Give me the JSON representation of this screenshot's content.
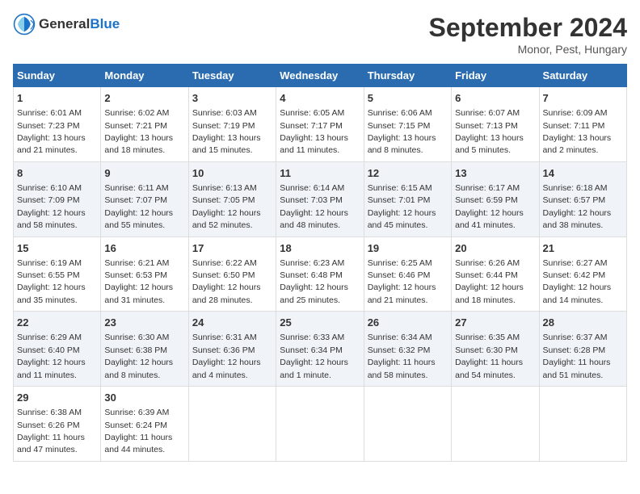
{
  "header": {
    "logo_general": "General",
    "logo_blue": "Blue",
    "title": "September 2024",
    "subtitle": "Monor, Pest, Hungary"
  },
  "columns": [
    "Sunday",
    "Monday",
    "Tuesday",
    "Wednesday",
    "Thursday",
    "Friday",
    "Saturday"
  ],
  "weeks": [
    [
      {
        "day": "1",
        "sunrise": "Sunrise: 6:01 AM",
        "sunset": "Sunset: 7:23 PM",
        "daylight": "Daylight: 13 hours and 21 minutes."
      },
      {
        "day": "2",
        "sunrise": "Sunrise: 6:02 AM",
        "sunset": "Sunset: 7:21 PM",
        "daylight": "Daylight: 13 hours and 18 minutes."
      },
      {
        "day": "3",
        "sunrise": "Sunrise: 6:03 AM",
        "sunset": "Sunset: 7:19 PM",
        "daylight": "Daylight: 13 hours and 15 minutes."
      },
      {
        "day": "4",
        "sunrise": "Sunrise: 6:05 AM",
        "sunset": "Sunset: 7:17 PM",
        "daylight": "Daylight: 13 hours and 11 minutes."
      },
      {
        "day": "5",
        "sunrise": "Sunrise: 6:06 AM",
        "sunset": "Sunset: 7:15 PM",
        "daylight": "Daylight: 13 hours and 8 minutes."
      },
      {
        "day": "6",
        "sunrise": "Sunrise: 6:07 AM",
        "sunset": "Sunset: 7:13 PM",
        "daylight": "Daylight: 13 hours and 5 minutes."
      },
      {
        "day": "7",
        "sunrise": "Sunrise: 6:09 AM",
        "sunset": "Sunset: 7:11 PM",
        "daylight": "Daylight: 13 hours and 2 minutes."
      }
    ],
    [
      {
        "day": "8",
        "sunrise": "Sunrise: 6:10 AM",
        "sunset": "Sunset: 7:09 PM",
        "daylight": "Daylight: 12 hours and 58 minutes."
      },
      {
        "day": "9",
        "sunrise": "Sunrise: 6:11 AM",
        "sunset": "Sunset: 7:07 PM",
        "daylight": "Daylight: 12 hours and 55 minutes."
      },
      {
        "day": "10",
        "sunrise": "Sunrise: 6:13 AM",
        "sunset": "Sunset: 7:05 PM",
        "daylight": "Daylight: 12 hours and 52 minutes."
      },
      {
        "day": "11",
        "sunrise": "Sunrise: 6:14 AM",
        "sunset": "Sunset: 7:03 PM",
        "daylight": "Daylight: 12 hours and 48 minutes."
      },
      {
        "day": "12",
        "sunrise": "Sunrise: 6:15 AM",
        "sunset": "Sunset: 7:01 PM",
        "daylight": "Daylight: 12 hours and 45 minutes."
      },
      {
        "day": "13",
        "sunrise": "Sunrise: 6:17 AM",
        "sunset": "Sunset: 6:59 PM",
        "daylight": "Daylight: 12 hours and 41 minutes."
      },
      {
        "day": "14",
        "sunrise": "Sunrise: 6:18 AM",
        "sunset": "Sunset: 6:57 PM",
        "daylight": "Daylight: 12 hours and 38 minutes."
      }
    ],
    [
      {
        "day": "15",
        "sunrise": "Sunrise: 6:19 AM",
        "sunset": "Sunset: 6:55 PM",
        "daylight": "Daylight: 12 hours and 35 minutes."
      },
      {
        "day": "16",
        "sunrise": "Sunrise: 6:21 AM",
        "sunset": "Sunset: 6:53 PM",
        "daylight": "Daylight: 12 hours and 31 minutes."
      },
      {
        "day": "17",
        "sunrise": "Sunrise: 6:22 AM",
        "sunset": "Sunset: 6:50 PM",
        "daylight": "Daylight: 12 hours and 28 minutes."
      },
      {
        "day": "18",
        "sunrise": "Sunrise: 6:23 AM",
        "sunset": "Sunset: 6:48 PM",
        "daylight": "Daylight: 12 hours and 25 minutes."
      },
      {
        "day": "19",
        "sunrise": "Sunrise: 6:25 AM",
        "sunset": "Sunset: 6:46 PM",
        "daylight": "Daylight: 12 hours and 21 minutes."
      },
      {
        "day": "20",
        "sunrise": "Sunrise: 6:26 AM",
        "sunset": "Sunset: 6:44 PM",
        "daylight": "Daylight: 12 hours and 18 minutes."
      },
      {
        "day": "21",
        "sunrise": "Sunrise: 6:27 AM",
        "sunset": "Sunset: 6:42 PM",
        "daylight": "Daylight: 12 hours and 14 minutes."
      }
    ],
    [
      {
        "day": "22",
        "sunrise": "Sunrise: 6:29 AM",
        "sunset": "Sunset: 6:40 PM",
        "daylight": "Daylight: 12 hours and 11 minutes."
      },
      {
        "day": "23",
        "sunrise": "Sunrise: 6:30 AM",
        "sunset": "Sunset: 6:38 PM",
        "daylight": "Daylight: 12 hours and 8 minutes."
      },
      {
        "day": "24",
        "sunrise": "Sunrise: 6:31 AM",
        "sunset": "Sunset: 6:36 PM",
        "daylight": "Daylight: 12 hours and 4 minutes."
      },
      {
        "day": "25",
        "sunrise": "Sunrise: 6:33 AM",
        "sunset": "Sunset: 6:34 PM",
        "daylight": "Daylight: 12 hours and 1 minute."
      },
      {
        "day": "26",
        "sunrise": "Sunrise: 6:34 AM",
        "sunset": "Sunset: 6:32 PM",
        "daylight": "Daylight: 11 hours and 58 minutes."
      },
      {
        "day": "27",
        "sunrise": "Sunrise: 6:35 AM",
        "sunset": "Sunset: 6:30 PM",
        "daylight": "Daylight: 11 hours and 54 minutes."
      },
      {
        "day": "28",
        "sunrise": "Sunrise: 6:37 AM",
        "sunset": "Sunset: 6:28 PM",
        "daylight": "Daylight: 11 hours and 51 minutes."
      }
    ],
    [
      {
        "day": "29",
        "sunrise": "Sunrise: 6:38 AM",
        "sunset": "Sunset: 6:26 PM",
        "daylight": "Daylight: 11 hours and 47 minutes."
      },
      {
        "day": "30",
        "sunrise": "Sunrise: 6:39 AM",
        "sunset": "Sunset: 6:24 PM",
        "daylight": "Daylight: 11 hours and 44 minutes."
      },
      null,
      null,
      null,
      null,
      null
    ]
  ]
}
